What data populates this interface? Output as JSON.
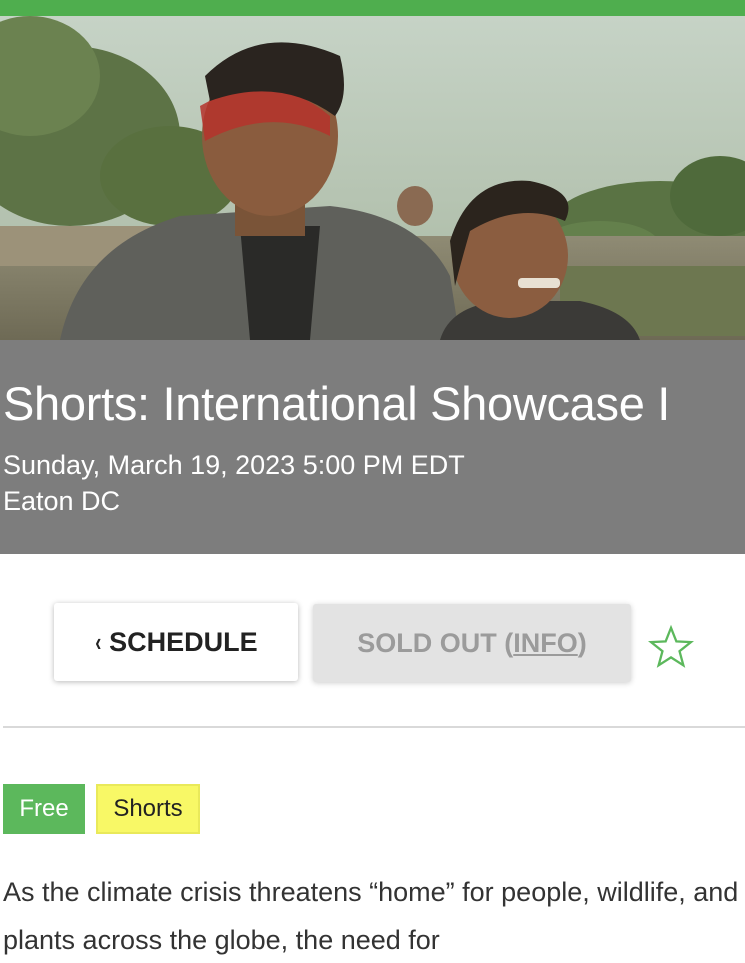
{
  "colors": {
    "brand_green": "#4fae4e",
    "panel_gray": "#7d7d7d",
    "free_tag": "#5cb85c",
    "shorts_tag": "#f8f866",
    "star_outline": "#5cb85c"
  },
  "hero": {
    "image_alt": "Film still: a man with red face paint and a boy riding a boat on a river"
  },
  "event": {
    "title": "Shorts: International Showcase I",
    "datetime": "Sunday, March 19, 2023 5:00 PM EDT",
    "venue": "Eaton DC"
  },
  "actions": {
    "schedule_chevron": "‹",
    "schedule_label": "SCHEDULE",
    "sold_out_label": "SOLD OUT (",
    "info_label": "INFO",
    "sold_out_close": ")",
    "favorite_icon": "star-outline-icon"
  },
  "tags": [
    {
      "label": "Free"
    },
    {
      "label": "Shorts"
    }
  ],
  "description": {
    "text": "As the climate crisis threatens “home” for people, wildlife, and plants across the globe, the need for"
  }
}
